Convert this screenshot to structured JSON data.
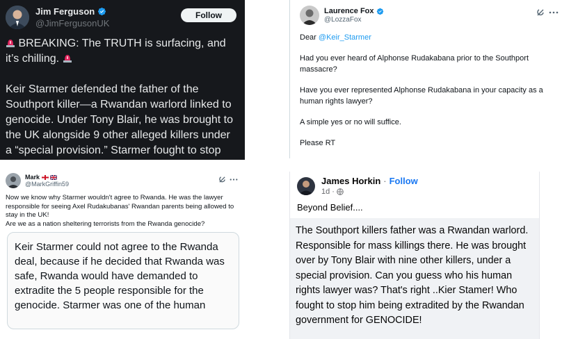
{
  "p1": {
    "name": "Jim Ferguson",
    "handle": "@JimFergusonUK",
    "follow_label": "Follow",
    "para1": "BREAKING: The TRUTH is surfacing, and it’s chilling.",
    "para2": "Keir Starmer defended the father of the Southport killer—a Rwandan warlord linked to genocide. Under Tony Blair, he was brought to the UK alongside 9 other alleged killers under a “special provision.” Starmer fought to stop his extradition for GENOCIDE.",
    "accent": "#1d9bf0",
    "siren_color": "#e0245e"
  },
  "p2": {
    "name": "Laurence Fox",
    "handle": "@LozzaFox",
    "salutation": "Dear",
    "mention": "@Keir_Starmer",
    "q1": "Had you ever heard of Alphonse Rudakabana prior to the Southport massacre?",
    "q2": "Have you ever represented Alphonse Rudakabana in your capacity as a human rights lawyer?",
    "q3": "A simple yes or no will suffice.",
    "q4": "Please RT"
  },
  "p3": {
    "name": "Mark",
    "handle": "@MarkGriffin59",
    "body": "Now we know why Starmer wouldn't agree to Rwanda. He was the lawyer responsible for seeing Axel Rudakubanas' Rwandan parents being allowed to stay in the UK!",
    "body2": "Are we as a nation sheltering terrorists from the Rwanda genocide?",
    "quote": "Keir Starmer could not agree to the Rwanda deal, because if he decided that Rwanda was safe, Rwanda would have demanded to extradite the 5 people responsible for the genocide. Starmer was one of the human"
  },
  "p4": {
    "name": "James Horkin",
    "separator": "·",
    "follow_label": "Follow",
    "time": "1d ·",
    "intro": "Beyond Belief....",
    "box_text": "The Southport killers father was a Rwandan warlord. Responsible for mass killings there. He was brought over by Tony Blair with nine other killers, under a special provision. Can you guess who his human rights lawyer was? That's right ..Kier Stamer! Who fought to stop him being extradited by the Rwandan government for GENOCIDE!",
    "follow_color": "#1877f2"
  }
}
